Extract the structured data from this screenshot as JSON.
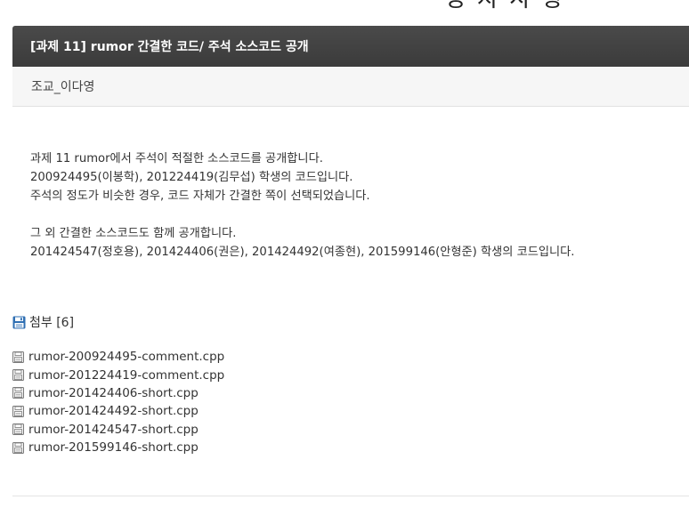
{
  "top_clip": "장 자 사 항",
  "post": {
    "title": "[과제 11] rumor 간결한 코드/ 주석 소스코드 공개",
    "author": "조교_이다영"
  },
  "content": {
    "lines": [
      "과제 11 rumor에서 주석이 적절한 소스코드를 공개합니다.",
      "200924495(이봉학), 201224419(김무섭) 학생의 코드입니다.",
      "주석의 정도가 비슷한 경우, 코드 자체가 간결한 쪽이 선택되었습니다.",
      "그 외 간결한 소스코드도 함께 공개합니다.",
      "201424547(정호용), 201424406(권은), 201424492(여종현), 201599146(안형준) 학생의 코드입니다."
    ]
  },
  "attachments": {
    "label": "첨부 [6]",
    "icon": "floppy-disk-icon",
    "icon_color": "#2f6fb3",
    "files": [
      "rumor-200924495-comment.cpp",
      "rumor-201224419-comment.cpp",
      "rumor-201424406-short.cpp",
      "rumor-201424492-short.cpp",
      "rumor-201424547-short.cpp",
      "rumor-201599146-short.cpp"
    ]
  },
  "colors": {
    "header_bg": "#3f3f3f",
    "author_bg": "#f6f6f6"
  }
}
